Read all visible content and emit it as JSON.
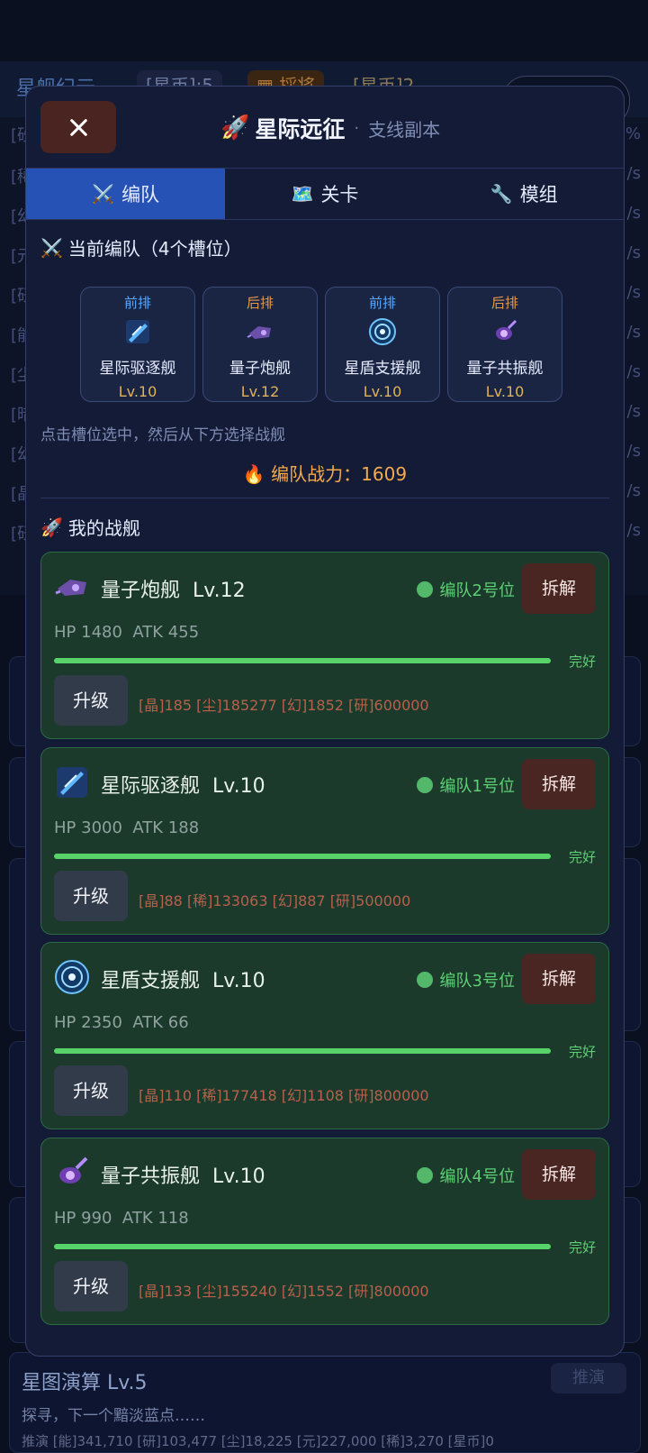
{
  "background": {
    "title": "星舰纪元",
    "tag_a": "[星币]:5",
    "tag_b": "▦ 採将",
    "tag_c": "[星币]2",
    "rows_left": [
      "[砂",
      "[稀",
      "[幻",
      "[元",
      "[研",
      "[能",
      "[尘",
      "[暗",
      "[幻",
      "[晶",
      "[研"
    ],
    "rows_right": [
      "%",
      "/s",
      "/s",
      "/s",
      "/s",
      "/s",
      "/s",
      "/s",
      "/s",
      "/s",
      "/s"
    ],
    "bottom_title": "星图演算 Lv.5",
    "bottom_sub": "探寻，下一个黯淡蓝点……",
    "bottom_button": "推演",
    "bottom_row": "推演 [能]341,710 [研]103,477 [尘]18,225 [元]227,000 [稀]3,270 [星币]0"
  },
  "modal": {
    "title": "星际远征",
    "separator": "·",
    "subtitle": "支线副本",
    "tabs": [
      {
        "icon": "⚔️",
        "label": "编队"
      },
      {
        "icon": "🗺️",
        "label": "关卡"
      },
      {
        "icon": "🔧",
        "label": "模组"
      }
    ],
    "formation_title": "当前编队（4个槽位）",
    "slots": [
      {
        "position": "前排",
        "name": "星际驱逐舰",
        "level": "Lv.10"
      },
      {
        "position": "后排",
        "name": "量子炮舰",
        "level": "Lv.12"
      },
      {
        "position": "前排",
        "name": "星盾支援舰",
        "level": "Lv.10"
      },
      {
        "position": "后排",
        "name": "量子共振舰",
        "level": "Lv.10"
      }
    ],
    "hint": "点击槽位选中，然后从下方选择战舰",
    "power_label": "编队战力：",
    "power_value": "1609",
    "my_ships_title": "我的战舰",
    "ships": [
      {
        "name": "量子炮舰",
        "level": "Lv.12",
        "status": "编队2号位",
        "hp": "HP 1480",
        "atk": "ATK 455",
        "health": "完好",
        "health_fraction": 1.0,
        "dismantle": "拆解",
        "upgrade": "升级",
        "cost": "[晶]185 [尘]185277 [幻]1852 [研]600000"
      },
      {
        "name": "星际驱逐舰",
        "level": "Lv.10",
        "status": "编队1号位",
        "hp": "HP 3000",
        "atk": "ATK 188",
        "health": "完好",
        "health_fraction": 1.0,
        "dismantle": "拆解",
        "upgrade": "升级",
        "cost": "[晶]88 [稀]133063 [幻]887 [研]500000"
      },
      {
        "name": "星盾支援舰",
        "level": "Lv.10",
        "status": "编队3号位",
        "hp": "HP 2350",
        "atk": "ATK 66",
        "health": "完好",
        "health_fraction": 1.0,
        "dismantle": "拆解",
        "upgrade": "升级",
        "cost": "[晶]110 [稀]177418 [幻]1108 [研]800000"
      },
      {
        "name": "量子共振舰",
        "level": "Lv.10",
        "status": "编队4号位",
        "hp": "HP 990",
        "atk": "ATK 118",
        "health": "完好",
        "health_fraction": 1.0,
        "dismantle": "拆解",
        "upgrade": "升级",
        "cost": "[晶]133 [尘]155240 [幻]1552 [研]800000"
      }
    ]
  }
}
